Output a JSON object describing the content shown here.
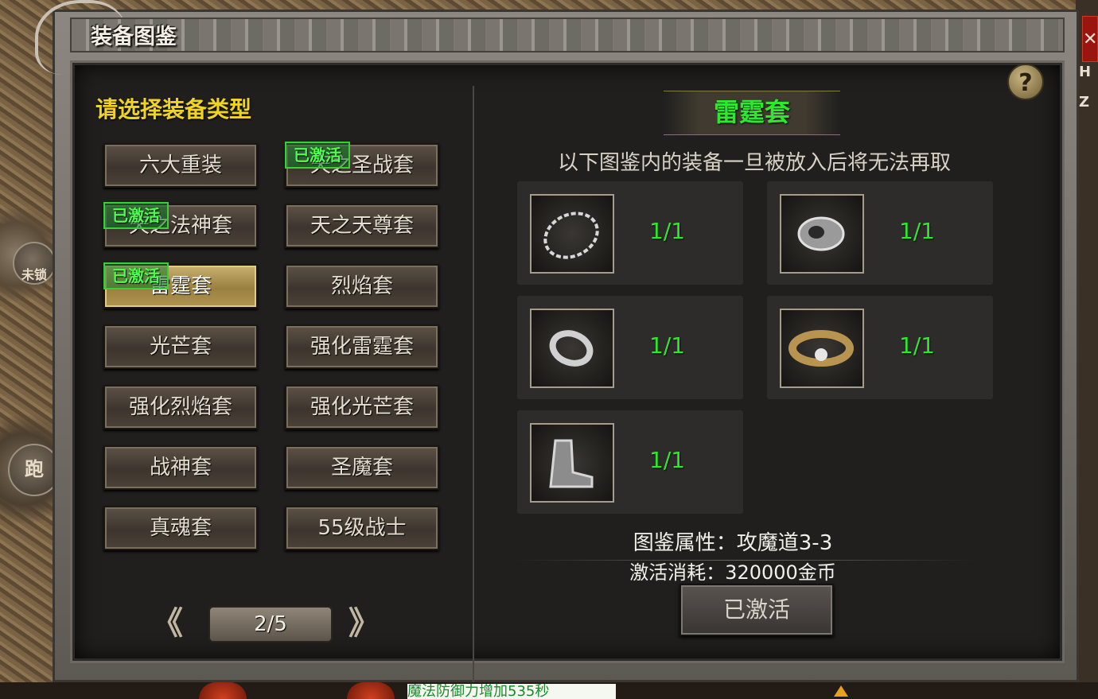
{
  "window": {
    "title": "装备图鉴",
    "close_label": "✕",
    "help_label": "?"
  },
  "left_panel": {
    "heading": "请选择装备类型",
    "categories": [
      {
        "label": "六大重装",
        "activated": false,
        "selected": false
      },
      {
        "label": "天之圣战套",
        "activated": true,
        "selected": false
      },
      {
        "label": "天之法神套",
        "activated": true,
        "selected": false
      },
      {
        "label": "天之天尊套",
        "activated": false,
        "selected": false
      },
      {
        "label": "雷霆套",
        "activated": true,
        "selected": true
      },
      {
        "label": "烈焰套",
        "activated": false,
        "selected": false
      },
      {
        "label": "光芒套",
        "activated": false,
        "selected": false
      },
      {
        "label": "强化雷霆套",
        "activated": false,
        "selected": false
      },
      {
        "label": "强化烈焰套",
        "activated": false,
        "selected": false
      },
      {
        "label": "强化光芒套",
        "activated": false,
        "selected": false
      },
      {
        "label": "战神套",
        "activated": false,
        "selected": false
      },
      {
        "label": "圣魔套",
        "activated": false,
        "selected": false
      },
      {
        "label": "真魂套",
        "activated": false,
        "selected": false
      },
      {
        "label": "55级战士",
        "activated": false,
        "selected": false
      }
    ],
    "activated_badge": "已激活",
    "pager": {
      "prev": "《",
      "next": "》",
      "current": "2/5"
    }
  },
  "right_panel": {
    "set_name": "雷霆套",
    "notice": "以下图鉴内的装备一旦被放入后将无法再取",
    "items": [
      {
        "icon": "necklace-icon",
        "count": "1/1"
      },
      {
        "icon": "bracelet-icon",
        "count": "1/1"
      },
      {
        "icon": "ring-icon",
        "count": "1/1"
      },
      {
        "icon": "belt-icon",
        "count": "1/1"
      },
      {
        "icon": "boots-icon",
        "count": "1/1"
      }
    ],
    "attribute": "图鉴属性：攻魔道3-3",
    "cost": "激活消耗：320000金币",
    "activate_button": "已激活"
  },
  "hud": {
    "lock_label": "未锁",
    "run_label": "跑",
    "ticker": "魔法防御力增加535秒",
    "side_glyphs": [
      "H",
      "Z"
    ]
  },
  "colors": {
    "heading": "#f0d420",
    "green": "#2ee82e",
    "panel_bg": "#201f1e"
  }
}
